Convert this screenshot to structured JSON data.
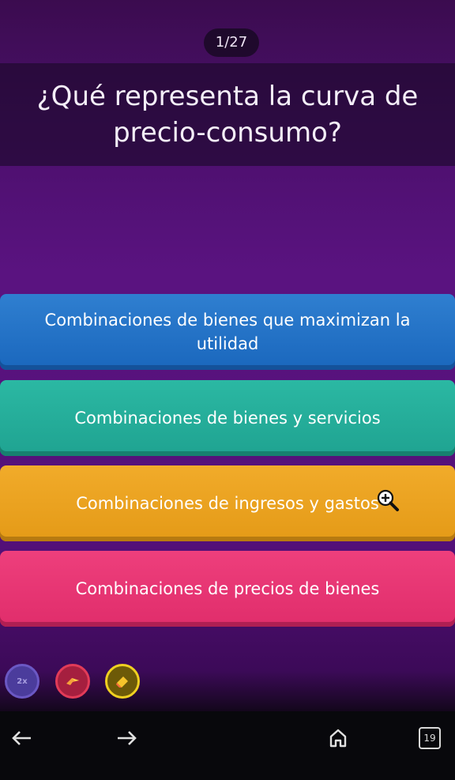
{
  "quiz": {
    "counter": "1/27",
    "question": "¿Qué representa la curva de precio-consumo?",
    "options": [
      {
        "label": "Combinaciones de bienes que maximizan la utilidad",
        "color": "#1f6ec4"
      },
      {
        "label": "Combinaciones de bienes y servicios",
        "color": "#24ac99"
      },
      {
        "label": "Combinaciones de ingresos y gastos",
        "color": "#eaa21f"
      },
      {
        "label": "Combinaciones de precios de bienes",
        "color": "#e63571"
      }
    ]
  },
  "powerups": [
    {
      "icon": "2x-powerup-icon",
      "label": "2x"
    },
    {
      "icon": "streak-powerup-icon"
    },
    {
      "icon": "eraser-powerup-icon"
    }
  ],
  "browser_nav": {
    "tab_count": "19",
    "icons": [
      "back-arrow-icon",
      "forward-arrow-icon",
      "home-icon",
      "tabs-icon"
    ]
  },
  "colors": {
    "background": "#54117a",
    "navbar": "#08080c"
  }
}
